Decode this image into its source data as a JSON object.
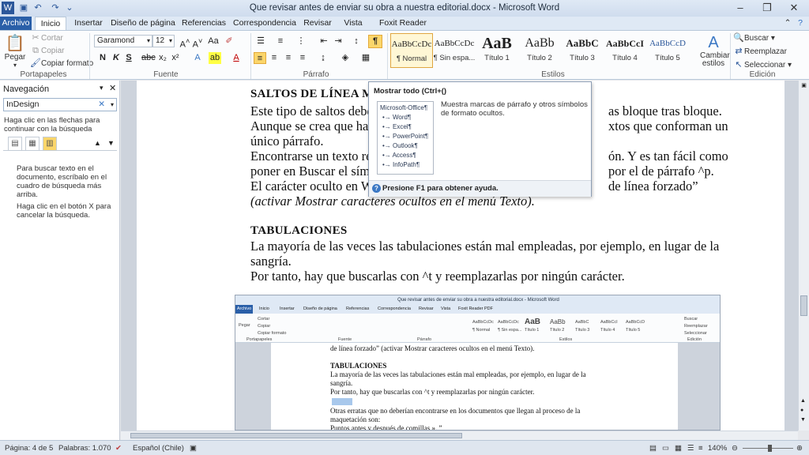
{
  "window": {
    "title": "Que revisar antes de enviar su obra a nuestra editorial.docx  -  Microsoft Word"
  },
  "tabs": [
    "Archivo",
    "Inicio",
    "Insertar",
    "Diseño de página",
    "Referencias",
    "Correspondencia",
    "Revisar",
    "Vista",
    "Foxit Reader PDF"
  ],
  "ribbon": {
    "portapapeles": {
      "label": "Portapapeles",
      "pegar": "Pegar",
      "cortar": "Cortar",
      "copiar": "Copiar",
      "copiar_formato": "Copiar formato"
    },
    "fuente": {
      "label": "Fuente",
      "font": "Garamond",
      "size": "12"
    },
    "parrafo": {
      "label": "Párrafo"
    },
    "estilos": {
      "label": "Estilos",
      "items": [
        {
          "preview": "AaBbCcDc",
          "name": "¶ Normal"
        },
        {
          "preview": "AaBbCcDc",
          "name": "¶ Sin espa..."
        },
        {
          "preview": "AaB",
          "name": "Título 1"
        },
        {
          "preview": "AaBb",
          "name": "Título 2"
        },
        {
          "preview": "AaBbC",
          "name": "Título 3"
        },
        {
          "preview": "AaBbCcI",
          "name": "Título 4"
        },
        {
          "preview": "AaBbCcD",
          "name": "Título 5"
        }
      ],
      "cambiar_estilos": "Cambiar estilos"
    },
    "edicion": {
      "label": "Edición",
      "buscar": "Buscar",
      "reemplazar": "Reemplazar",
      "seleccionar": "Seleccionar"
    }
  },
  "nav": {
    "title": "Navegación",
    "search_value": "InDesign",
    "hint": "Haga clic en las flechas para continuar con la búsqueda",
    "msg1": "Para buscar texto en el documento, escríbalo en el cuadro de búsqueda más arriba.",
    "msg2": "Haga clic en el botón X para cancelar la búsqueda."
  },
  "document": {
    "lines": [
      "SALTOS DE LÍNEA MANU",
      "Este tipo de saltos debe ev",
      "Aunque se crea que hay va",
      "único párrafo.",
      "Encontrarse un texto reple",
      "poner en Buscar el símbolo",
      "El carácter oculto en Wor",
      "(activar Mostrar caracteres ocultos en el menú Texto).",
      "",
      "TABULACIONES",
      "La mayoría de las veces las tabulaciones están mal empleadas, por ejemplo, en lugar de la",
      "sangría.",
      "Por tanto, hay que buscarlas con ^t y reemplazarlas por ningún carácter."
    ],
    "right_fragments": [
      "as bloque tras bloque.",
      "xtos que conforman un",
      "ón. Y es tan fácil como",
      "por el de párrafo ^p.",
      "de línea forzado”"
    ]
  },
  "tooltip": {
    "title": "Mostrar todo (Ctrl+()",
    "thumb_lines": [
      "Microsoft-Office¶",
      "•→ Word¶",
      "•→ Excel¶",
      "•→ PowerPoint¶",
      "•→ Outlook¶",
      "•→ Access¶",
      "•→ InfoPath¶"
    ],
    "description": "Muestra marcas de párrafo y otros símbolos de formato ocultos.",
    "footer": "Presione F1 para obtener ayuda."
  },
  "embedded": {
    "title": "Que revisar antes de enviar su obra a nuestra editorial.docx  -  Microsoft Word",
    "tabs": [
      "Archivo",
      "Inicio",
      "Insertar",
      "Diseño de página",
      "Referencias",
      "Correspondencia",
      "Revisar",
      "Vista",
      "Foxit Reader PDF"
    ],
    "lines": [
      "de línea forzado” (activar Mostrar caracteres ocultos en el menú Texto).",
      "",
      "TABULACIONES",
      "La mayoría de las veces las tabulaciones están mal empleadas, por ejemplo, en lugar de la",
      "sangría.",
      "Por tanto, hay que buscarlas con ^t y reemplazarlas por ningún carácter.",
      "",
      "Otras erratas que no deberían encontrarse en los documentos que llegan al proceso de la",
      "maquetación son:",
      "Puntos antes y después de comillas ». ”"
    ]
  },
  "status": {
    "pagina": "Página: 4 de 5",
    "palabras": "Palabras: 1.070",
    "idioma": "Español (Chile)",
    "zoom": "140%"
  }
}
